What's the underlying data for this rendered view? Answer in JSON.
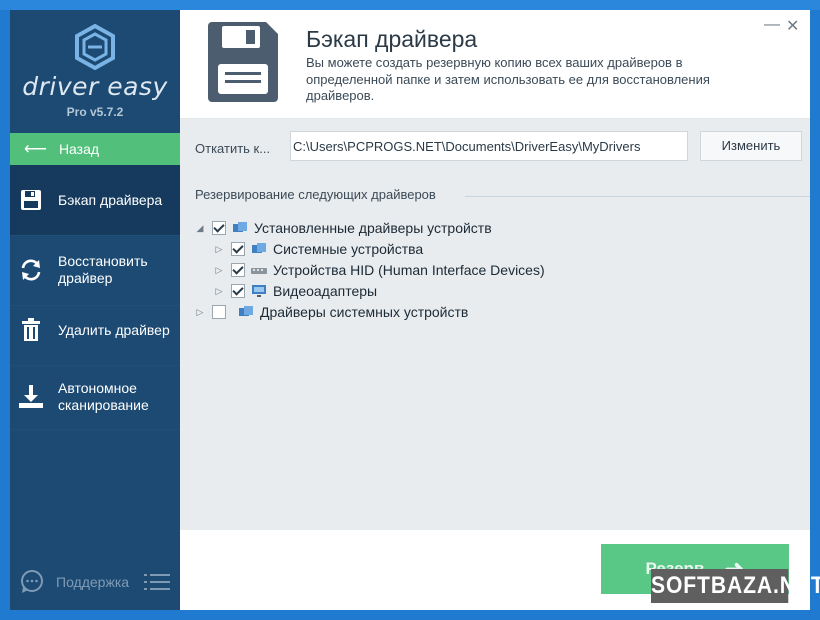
{
  "app": {
    "name": "driver easy",
    "version": "Pro v5.7.2"
  },
  "sidebar": {
    "back_label": "Назад",
    "items": [
      {
        "label": "Бэкап драйвера",
        "icon": "floppy-icon",
        "active": true
      },
      {
        "label": "Восстановить драйвер",
        "icon": "restore-icon",
        "active": false
      },
      {
        "label": "Удалить драйвер",
        "icon": "trash-icon",
        "active": false
      },
      {
        "label": "Автономное сканирование",
        "icon": "download-icon",
        "active": false
      }
    ],
    "support_label": "Поддержка"
  },
  "header": {
    "title": "Бэкап драйвера",
    "subtitle": "Вы можете создать резервную копию всех ваших драйверов в определенной папке и затем использовать ее для восстановления драйверов."
  },
  "path": {
    "label": "Откатить к...",
    "value": "C:\\Users\\PCPROGS.NET\\Documents\\DriverEasy\\MyDrivers",
    "change_label": "Изменить"
  },
  "section": {
    "title": "Резервирование следующих драйверов"
  },
  "tree": [
    {
      "label": "Установленные драйверы устройств",
      "checked": true,
      "expanded": true,
      "icon": "device-group-icon"
    },
    {
      "label": "Системные устройства",
      "checked": true,
      "expanded": false,
      "icon": "system-devices-icon"
    },
    {
      "label": "Устройства HID (Human Interface Devices)",
      "checked": true,
      "expanded": false,
      "icon": "hid-icon"
    },
    {
      "label": "Видеоадаптеры",
      "checked": true,
      "expanded": false,
      "icon": "display-adapter-icon"
    },
    {
      "label": "Драйверы системных устройств",
      "checked": false,
      "expanded": false,
      "icon": "device-group-icon"
    }
  ],
  "footer": {
    "backup_label": "Резерв"
  },
  "watermark": "SOFTBAZA.NET",
  "colors": {
    "sidebar_bg": "#1c4a73",
    "sidebar_active": "#153a5d",
    "accent_green": "#52c07a",
    "content_bg": "#e9ecee"
  }
}
